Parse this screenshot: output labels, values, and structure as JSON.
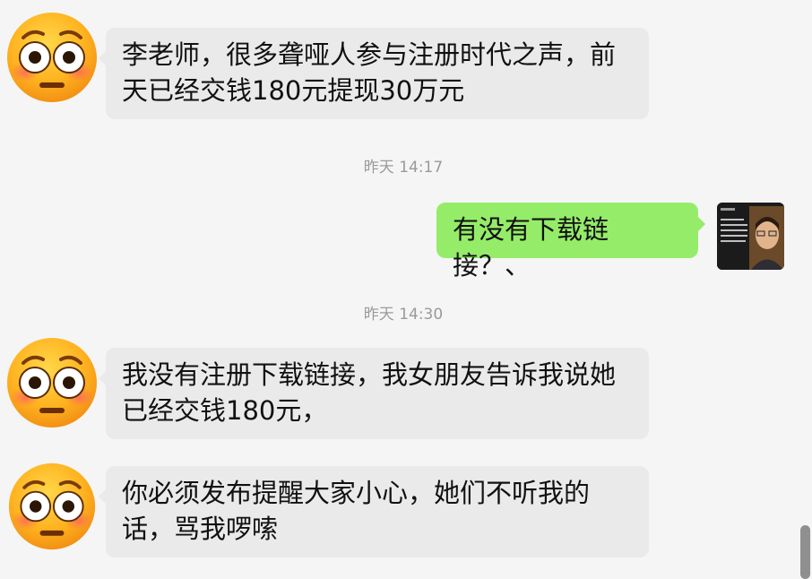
{
  "messages": [
    {
      "text": "李老师，很多聋哑人参与注册时代之声，前天已经交钱180元提现30万元"
    },
    {
      "time": "昨天 14:17"
    },
    {
      "text": "有没有下载链接？、"
    },
    {
      "time": "昨天 14:30"
    },
    {
      "text": "我没有注册下载链接，我女朋友告诉我说她已经交钱180元，"
    },
    {
      "text": "你必须发布提醒大家小心，她们不听我的话，骂我啰嗦"
    }
  ],
  "avatar_icon": "flushed-face-emoji",
  "colors": {
    "incoming_bubble": "#eaeaea",
    "outgoing_bubble": "#95ec69",
    "background": "#f5f5f5"
  }
}
